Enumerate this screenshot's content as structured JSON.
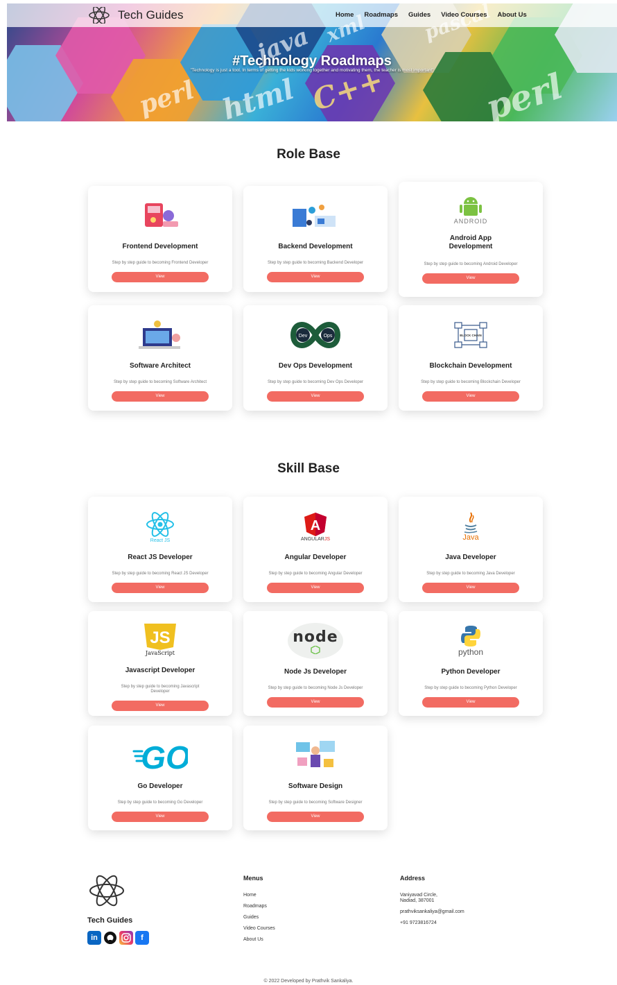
{
  "brand": {
    "name": "Tech Guides"
  },
  "nav": [
    "Home",
    "Roadmaps",
    "Guides",
    "Video Courses",
    "About Us"
  ],
  "hero": {
    "title": "#Technology Roadmaps",
    "quote": "\"Technology is just a tool. In terms of getting the kids working together and motivating them, the teacher is most important\"",
    "decor_words": [
      "java",
      "perl",
      "html",
      "C++",
      "perl",
      "xml",
      "pascal"
    ]
  },
  "role_base": {
    "title": "Role Base",
    "cards": [
      {
        "title": "Frontend Development",
        "desc": "Step by step guide to becoming Frontend Developer",
        "button": "View",
        "icon": "frontend-illustration-icon"
      },
      {
        "title": "Backend Development",
        "desc": "Step by step guide to becoming Backend Developer",
        "button": "View",
        "icon": "backend-illustration-icon"
      },
      {
        "title": "Android App Development",
        "desc": "Step by step guide to becoming Android Developer",
        "button": "View",
        "icon": "android-logo-icon",
        "logo_text": "ANDROID"
      },
      {
        "title": "Software Architect",
        "desc": "Step by step guide to becoming Software Architect",
        "button": "View",
        "icon": "architect-illustration-icon"
      },
      {
        "title": "Dev Ops Development",
        "desc": "Step by step guide to becoming Dev Ops Developer",
        "button": "View",
        "icon": "devops-logo-icon",
        "logo_text": [
          "Dev",
          "Ops"
        ]
      },
      {
        "title": "Blockchain Development",
        "desc": "Step by step guide to becoming Blockchain Developer",
        "button": "View",
        "icon": "blockchain-logo-icon",
        "logo_text": "BLOCK CHAIN"
      }
    ]
  },
  "skill_base": {
    "title": "Skill Base",
    "cards": [
      {
        "title": "React JS Developer",
        "desc": "Step by step guide to becoming React JS Developer",
        "button": "View",
        "icon": "react-logo-icon",
        "logo_text": "React JS"
      },
      {
        "title": "Angular Developer",
        "desc": "Step by step guide to becoming Angular Developer",
        "button": "View",
        "icon": "angular-logo-icon",
        "logo_text": [
          "ANGULAR",
          "JS"
        ]
      },
      {
        "title": "Java Developer",
        "desc": "Step by step guide to becoming Java Developer",
        "button": "View",
        "icon": "java-logo-icon",
        "logo_text": "Java"
      },
      {
        "title": "Javascript Developer",
        "desc": "Step by step guide to becoming Javascript Developer",
        "button": "View",
        "icon": "javascript-logo-icon",
        "logo_text": [
          "JS",
          "JavaScript"
        ]
      },
      {
        "title": "Node Js Developer",
        "desc": "Step by step guide to becoming Node Js Developer",
        "button": "View",
        "icon": "nodejs-logo-icon",
        "logo_text": "node"
      },
      {
        "title": "Python Developer",
        "desc": "Step by step guide to becoming Python Developer",
        "button": "View",
        "icon": "python-logo-icon",
        "logo_text": "python"
      },
      {
        "title": "Go Developer",
        "desc": "Step by step guide to becoming Go Developer",
        "button": "View",
        "icon": "go-logo-icon",
        "logo_text": "GO"
      },
      {
        "title": "Software Design",
        "desc": "Step by step guide to becoming Software Designer",
        "button": "View",
        "icon": "software-design-illustration-icon"
      }
    ]
  },
  "footer": {
    "brand": "Tech Guides",
    "menus_title": "Menus",
    "menus": [
      "Home",
      "Roadmaps",
      "Guides",
      "Video Courses",
      "About Us"
    ],
    "address_title": "Address",
    "address_lines": [
      "Vaniyavad Circle,",
      "Nadiad, 387001"
    ],
    "email": "prathviksankaliya@gmail.com",
    "phone": "+91 9723816724",
    "social": [
      {
        "icon": "linkedin-icon",
        "color": "#0a66c2"
      },
      {
        "icon": "github-icon",
        "color": "#111111"
      },
      {
        "icon": "instagram-icon",
        "color": "#d6249f"
      },
      {
        "icon": "facebook-icon",
        "color": "#1877f2"
      }
    ],
    "copyright": "© 2022 Developed by Prathvik Sankaliya."
  },
  "colors": {
    "button": "#f26b62",
    "text": "#222222"
  }
}
